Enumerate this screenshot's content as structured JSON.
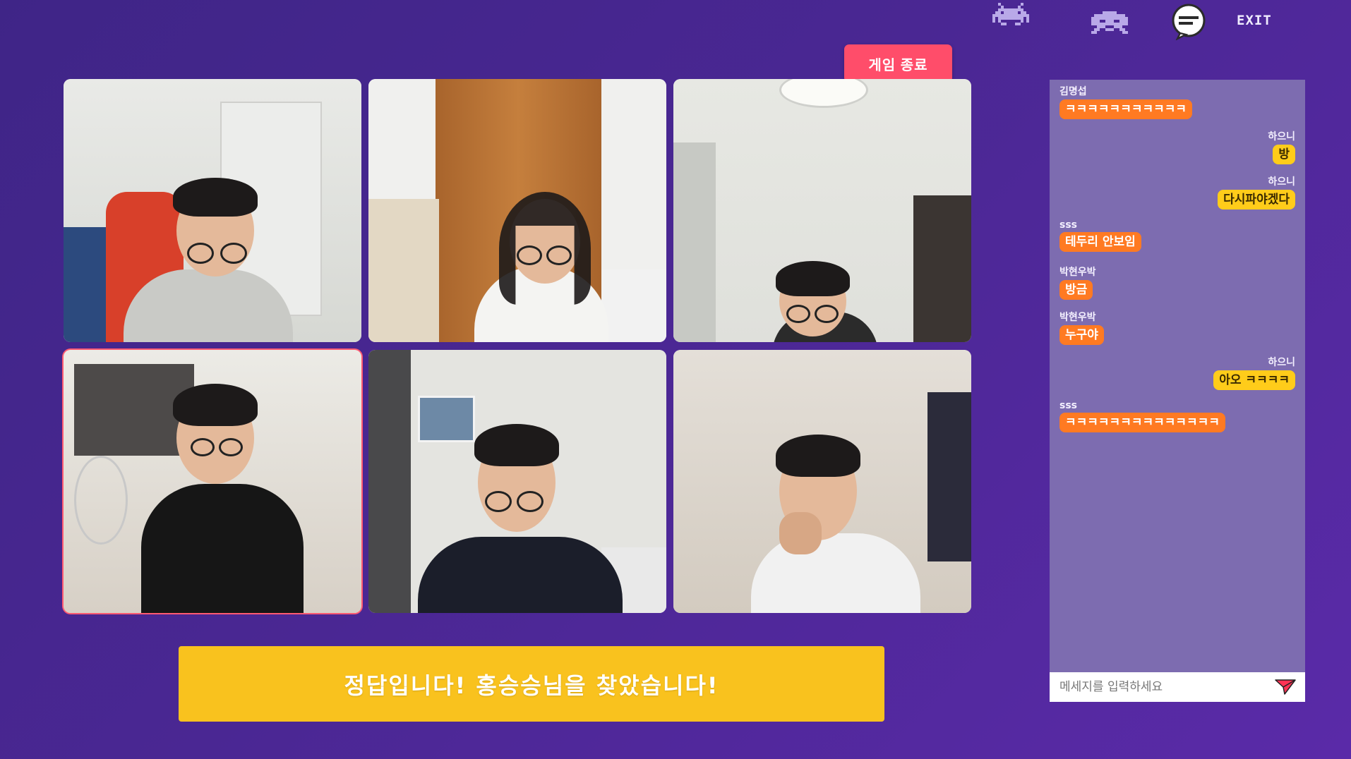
{
  "header": {
    "icons": [
      "space-invader-icon",
      "space-invader-alt-icon",
      "chat-bubble-icon"
    ],
    "exit_label": "EXIT",
    "end_game_label": "게임 종료"
  },
  "video_grid": {
    "tiles": [
      {
        "id": "tile-1",
        "active": false
      },
      {
        "id": "tile-2",
        "active": false
      },
      {
        "id": "tile-3",
        "active": false
      },
      {
        "id": "tile-4",
        "active": true
      },
      {
        "id": "tile-5",
        "active": false
      },
      {
        "id": "tile-6",
        "active": false
      }
    ]
  },
  "banner": {
    "text": "정답입니다!  홍승승님을  찾았습니다!"
  },
  "chat": {
    "messages": [
      {
        "sender": "김명섭",
        "text": "ㅋㅋㅋㅋㅋㅋㅋㅋㅋㅋㅋ",
        "side": "left"
      },
      {
        "sender": "하으니",
        "text": "방",
        "side": "right"
      },
      {
        "sender": "하으니",
        "text": "다시파야겠다",
        "side": "right"
      },
      {
        "sender": "sss",
        "text": "테두리 안보임",
        "side": "left"
      },
      {
        "sender": "박현우박",
        "text": "방금",
        "side": "left"
      },
      {
        "sender": "박현우박",
        "text": "누구야",
        "side": "left"
      },
      {
        "sender": "하으니",
        "text": "아오 ㅋㅋㅋㅋ",
        "side": "right"
      },
      {
        "sender": "sss",
        "text": "ㅋㅋㅋㅋㅋㅋㅋㅋㅋㅋㅋㅋㅋㅋ",
        "side": "left"
      }
    ],
    "input_placeholder": "메세지를 입력하세요",
    "send_icon": "send-arrow-icon"
  },
  "colors": {
    "background": "#4a2793",
    "end_button": "#ff4d6a",
    "banner": "#f9c21e",
    "chat_panel": "#7d6cb0",
    "bubble_left": "#ff7a22",
    "bubble_right": "#ffcc1a"
  }
}
